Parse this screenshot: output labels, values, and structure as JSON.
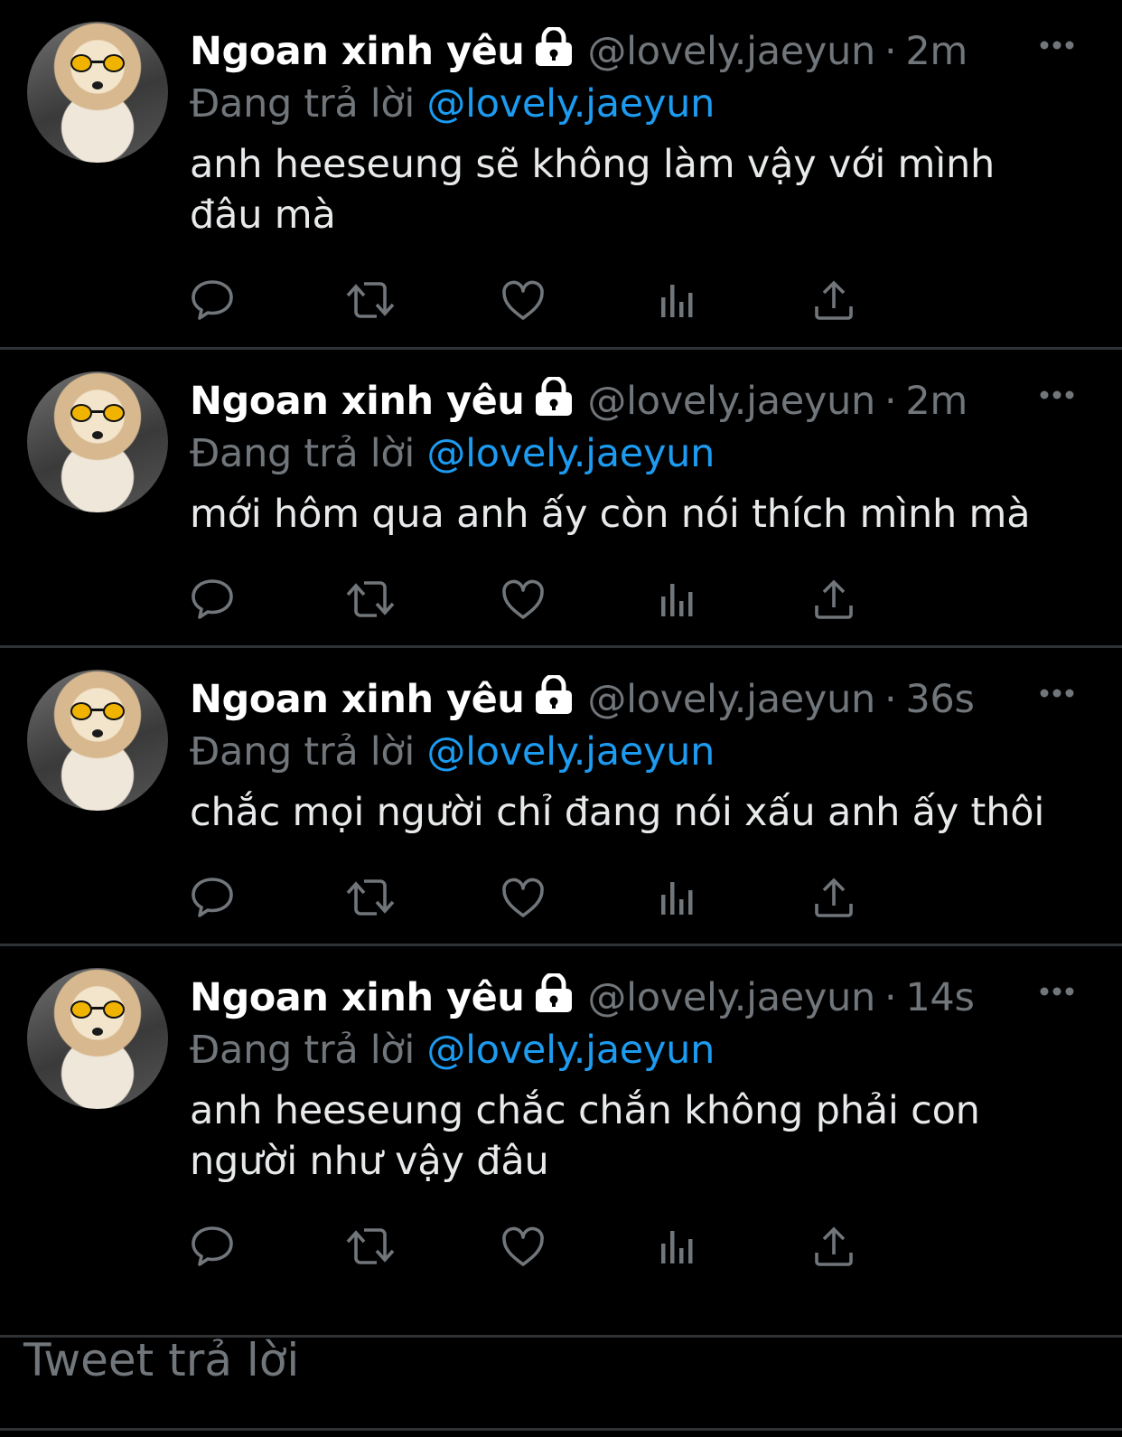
{
  "tweets": [
    {
      "name": "Ngoan xinh yêu",
      "handle": "@lovely.jaeyun",
      "time": "2m",
      "replying_prefix": "Đang trả lời",
      "replying_to": "@lovely.jaeyun",
      "text": "anh heeseung sẽ không làm vậy với mình\nđâu mà"
    },
    {
      "name": "Ngoan xinh yêu",
      "handle": "@lovely.jaeyun",
      "time": "2m",
      "replying_prefix": "Đang trả lời",
      "replying_to": "@lovely.jaeyun",
      "text": "mới hôm qua anh ấy còn nói thích mình mà"
    },
    {
      "name": "Ngoan xinh yêu",
      "handle": "@lovely.jaeyun",
      "time": "36s",
      "replying_prefix": "Đang trả lời",
      "replying_to": "@lovely.jaeyun",
      "text": "chắc mọi người chỉ đang nói xấu anh ấy thôi"
    },
    {
      "name": "Ngoan xinh yêu",
      "handle": "@lovely.jaeyun",
      "time": "14s",
      "replying_prefix": "Đang trả lời",
      "replying_to": "@lovely.jaeyun",
      "text": "anh heeseung chắc chắn không phải con\nngười như vậy đâu"
    }
  ],
  "composer": {
    "placeholder": "Tweet trả lời"
  },
  "separator": "·",
  "icons": {
    "reply": "reply-icon",
    "retweet": "retweet-icon",
    "like": "heart-icon",
    "views": "views-icon",
    "share": "share-icon",
    "more": "more-icon",
    "lock": "lock-icon"
  },
  "colors": {
    "background": "#000000",
    "primary_text": "#e7e9ea",
    "secondary_text": "#71767b",
    "link": "#1d9bf0",
    "divider": "#2f3336"
  }
}
